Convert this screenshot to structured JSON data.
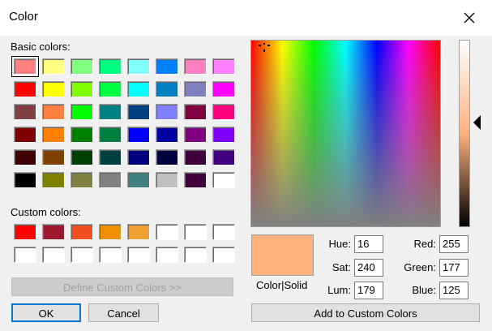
{
  "dialog": {
    "title": "Color",
    "basic_colors_label": "Basic colors:",
    "custom_colors_label": "Custom colors:",
    "define_button": "Define Custom Colors >>",
    "ok_button": "OK",
    "cancel_button": "Cancel",
    "add_button": "Add to Custom Colors",
    "preview_label": "Color|Solid"
  },
  "basic_colors": [
    "#ff8080",
    "#ffff80",
    "#80ff80",
    "#00ff80",
    "#80ffff",
    "#0080ff",
    "#ff80c0",
    "#ff80ff",
    "#ff0000",
    "#ffff00",
    "#80ff00",
    "#00ff40",
    "#00ffff",
    "#0080c0",
    "#8080c0",
    "#ff00ff",
    "#804040",
    "#ff8040",
    "#00ff00",
    "#008080",
    "#004080",
    "#8080ff",
    "#800040",
    "#ff0080",
    "#800000",
    "#ff8000",
    "#008000",
    "#008040",
    "#0000ff",
    "#0000a0",
    "#800080",
    "#8000ff",
    "#400000",
    "#804000",
    "#004000",
    "#004040",
    "#000080",
    "#000040",
    "#400040",
    "#400080",
    "#000000",
    "#808000",
    "#808040",
    "#808080",
    "#408080",
    "#c0c0c0",
    "#400040",
    "#ffffff"
  ],
  "custom_colors": [
    "#ff0000",
    "#a01830",
    "#f05020",
    "#f09000",
    "#f0a030",
    "#ffffff",
    "#ffffff",
    "#ffffff",
    "#ffffff",
    "#ffffff",
    "#ffffff",
    "#ffffff",
    "#ffffff",
    "#ffffff",
    "#ffffff",
    "#ffffff"
  ],
  "selected_color": "#ffb17d",
  "fields": {
    "hue_label": "Hue:",
    "hue": "16",
    "sat_label": "Sat:",
    "sat": "240",
    "lum_label": "Lum:",
    "lum": "179",
    "red_label": "Red:",
    "red": "255",
    "green_label": "Green:",
    "green": "177",
    "blue_label": "Blue:",
    "blue": "125"
  },
  "luminance_fraction": 0.75,
  "icons": {
    "close": "close-icon",
    "crosshair": "crosshair-icon",
    "lum_pointer": "triangle-left-icon"
  }
}
